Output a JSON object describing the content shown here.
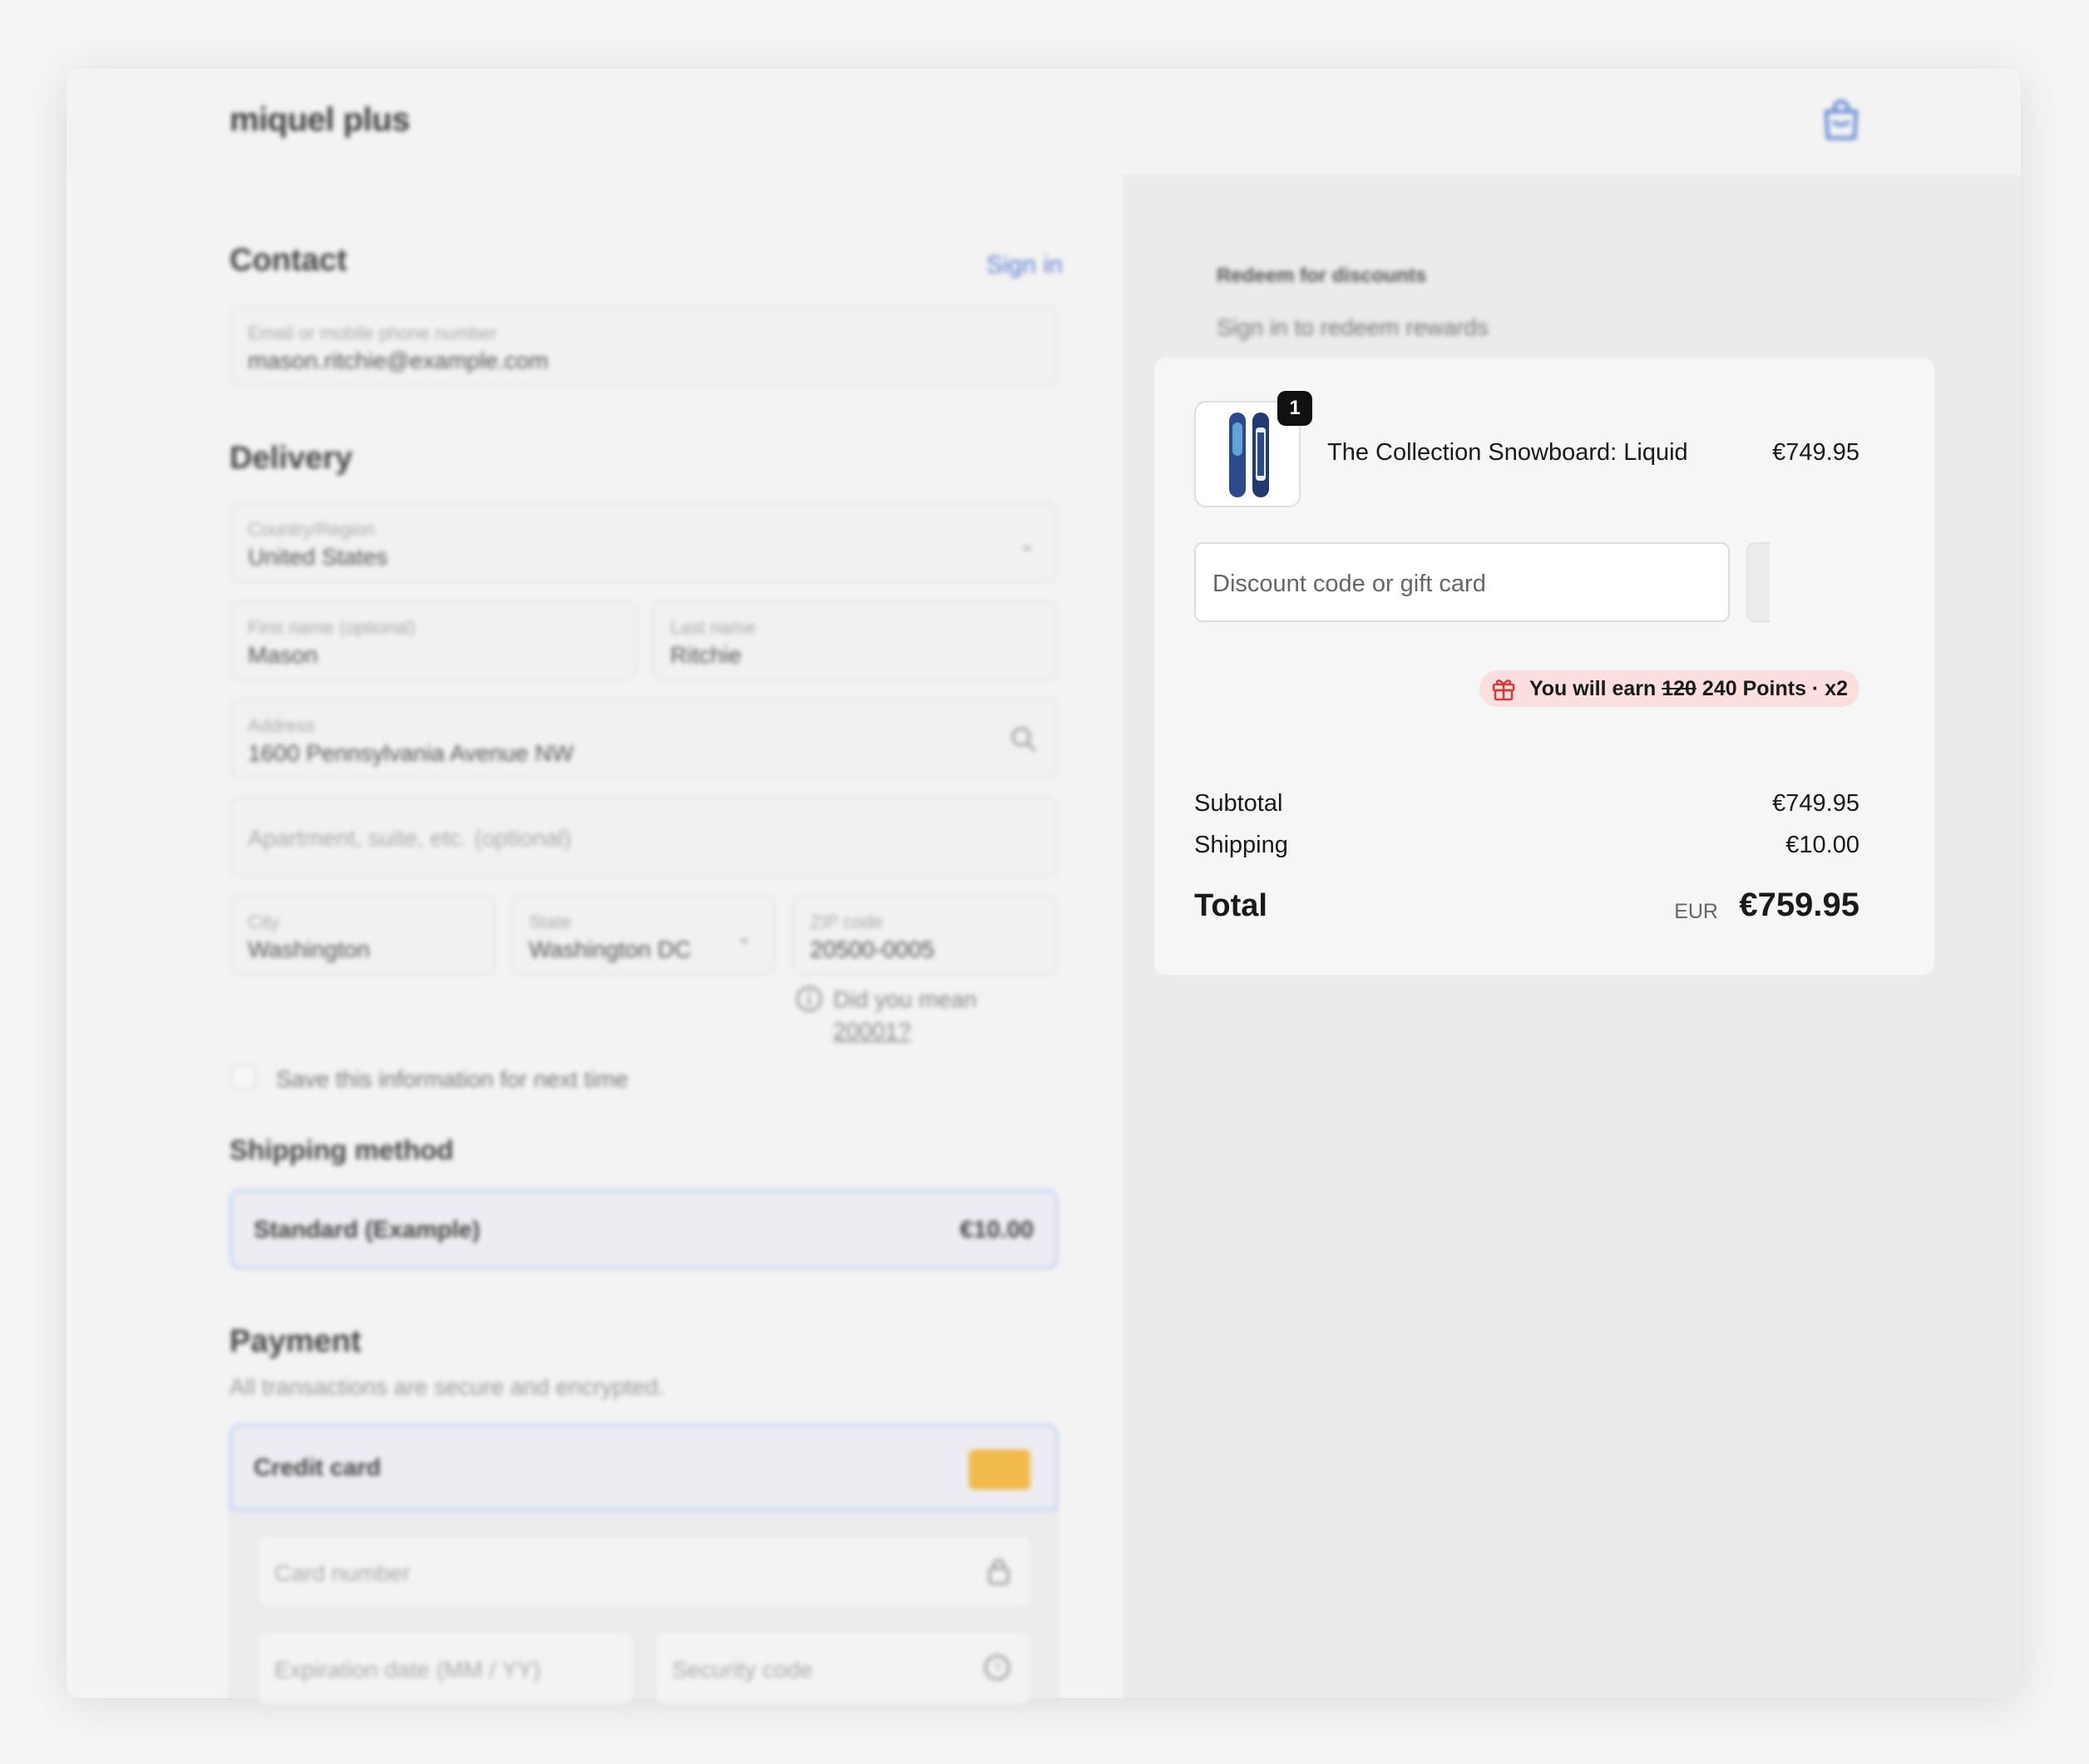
{
  "header": {
    "brand": "miquel plus",
    "cart_icon": "shopping-bag-icon"
  },
  "contact": {
    "title": "Contact",
    "sign_in": "Sign in",
    "email_label": "Email or mobile phone number",
    "email_value": "mason.ritchie@example.com"
  },
  "delivery": {
    "title": "Delivery",
    "country_label": "Country/Region",
    "country_value": "United States",
    "first_label": "First name (optional)",
    "first_value": "Mason",
    "last_label": "Last name",
    "last_value": "Ritchie",
    "address_label": "Address",
    "address_value": "1600 Pennsylvania Avenue NW",
    "apt_placeholder": "Apartment, suite, etc. (optional)",
    "city_label": "City",
    "city_value": "Washington",
    "state_label": "State",
    "state_value": "Washington DC",
    "zip_label": "ZIP code",
    "zip_value": "20500-0005",
    "zip_hint": "Did you mean",
    "zip_suggest": "20001",
    "zip_suggest_suffix": "?",
    "save_info": "Save this information for next time"
  },
  "shipping_method": {
    "title": "Shipping method",
    "option_name": "Standard (Example)",
    "option_price": "€10.00"
  },
  "payment": {
    "title": "Payment",
    "subtitle": "All transactions are secure and encrypted.",
    "method": "Credit card",
    "card_placeholder": "Card number",
    "expiry_placeholder": "Expiration date (MM / YY)",
    "cvv_placeholder": "Security code"
  },
  "rewards": {
    "title": "Redeem for discounts",
    "subtitle": "Sign in to redeem rewards"
  },
  "summary": {
    "quantity": "1",
    "product_name": "The Collection Snowboard: Liquid",
    "product_price": "€749.95",
    "discount_placeholder": "Discount code or gift card",
    "points_prefix": "You will earn",
    "points_old": "120",
    "points_new": "240 Points · x2",
    "subtotal_label": "Subtotal",
    "subtotal_value": "€749.95",
    "shipping_label": "Shipping",
    "shipping_value": "€10.00",
    "total_label": "Total",
    "total_currency": "EUR",
    "total_value": "€759.95"
  },
  "colors": {
    "accent": "#5a7fd1",
    "points_bg": "#fbdede",
    "gift_red": "#d83a3a"
  }
}
